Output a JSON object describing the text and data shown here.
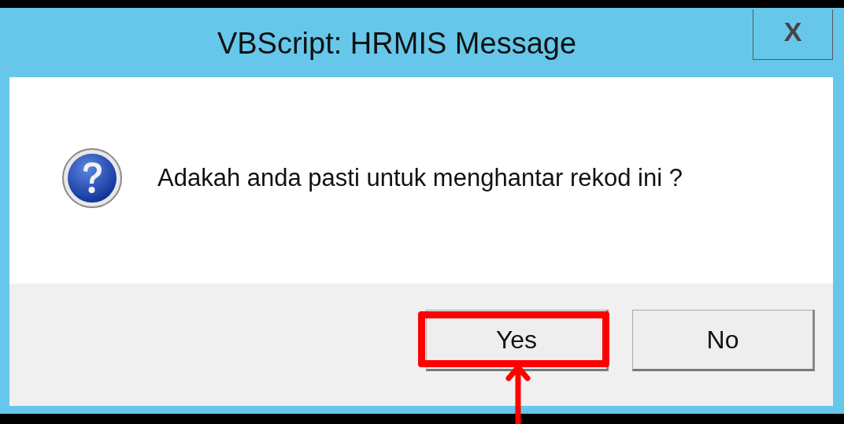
{
  "window": {
    "title": "VBScript: HRMIS Message",
    "close_label": "X"
  },
  "message": {
    "kind": "question",
    "text": "Adakah anda pasti untuk menghantar rekod ini ?"
  },
  "buttons": [
    {
      "label": "Yes",
      "highlighted": true
    },
    {
      "label": "No",
      "highlighted": false
    }
  ]
}
